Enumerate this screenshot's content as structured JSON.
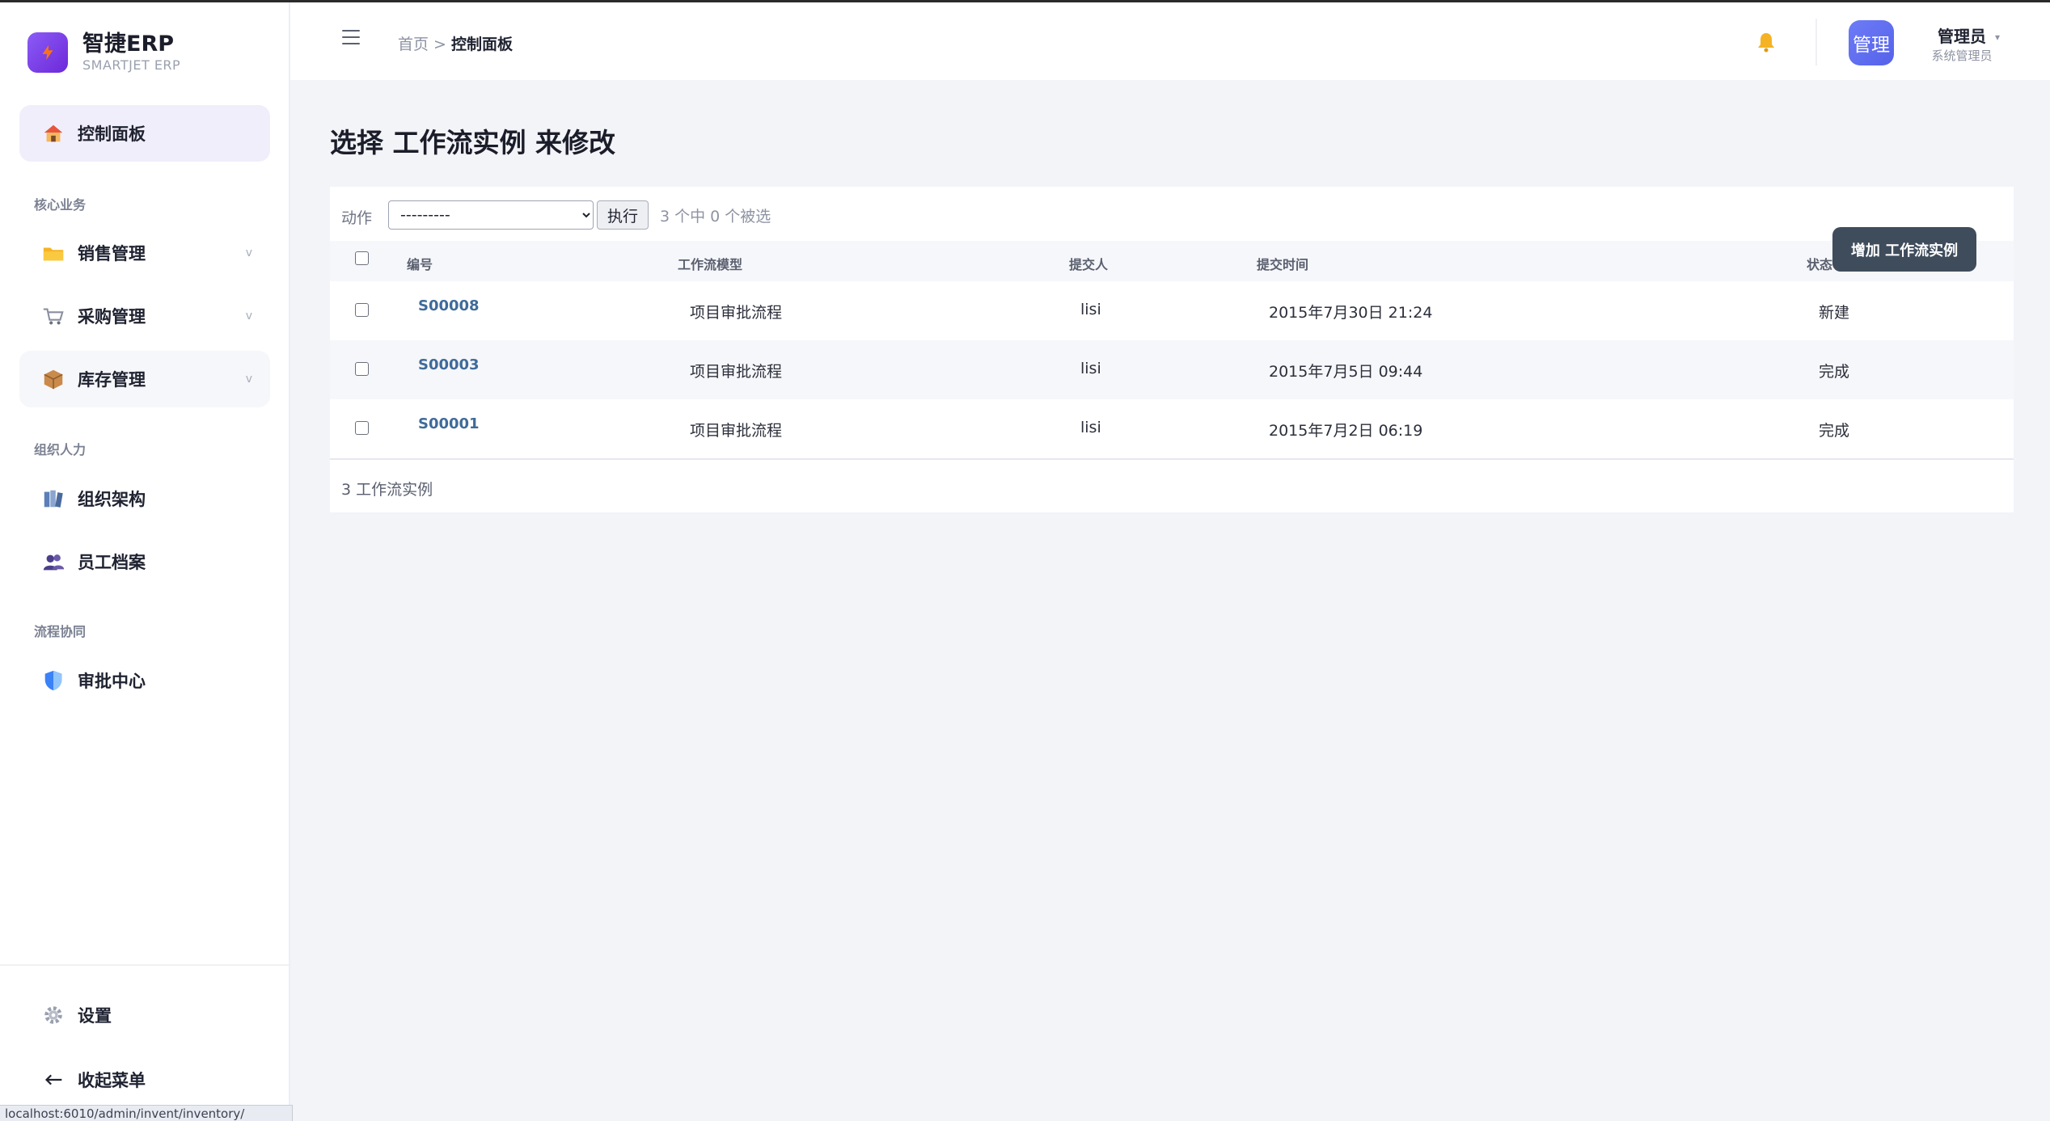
{
  "brand": {
    "name": "智捷ERP",
    "subtitle": "SMARTJET ERP"
  },
  "sidebar": {
    "items": [
      {
        "label": "控制面板",
        "icon": "house-icon"
      },
      {
        "label": "销售管理",
        "icon": "folder-icon"
      },
      {
        "label": "采购管理",
        "icon": "cart-icon"
      },
      {
        "label": "库存管理",
        "icon": "package-icon"
      },
      {
        "label": "组织架构",
        "icon": "books-icon"
      },
      {
        "label": "员工档案",
        "icon": "people-icon"
      },
      {
        "label": "审批中心",
        "icon": "shield-icon"
      }
    ],
    "sections": [
      "核心业务",
      "组织人力",
      "流程协同"
    ],
    "chevron": "v",
    "bottom": {
      "settings_label": "设置",
      "collapse_label": "收起菜单"
    }
  },
  "header": {
    "breadcrumb_home": "首页",
    "breadcrumb_sep": ">",
    "breadcrumb_current": "控制面板",
    "user": {
      "avatar_text": "管理",
      "name": "管理员",
      "role": "系统管理员"
    }
  },
  "page": {
    "title": "选择 工作流实例 来修改",
    "add_button": "增加 工作流实例",
    "action_label": "动作",
    "action_select_value": "---------",
    "action_go": "执行",
    "action_counter": "3 个中 0 个被选",
    "result_count": "3 工作流实例"
  },
  "table": {
    "columns": [
      "编号",
      "工作流模型",
      "提交人",
      "提交时间",
      "状态"
    ],
    "rows": [
      {
        "id": "S00008",
        "model": "项目审批流程",
        "submitter": "lisi",
        "time": "2015年7月30日 21:24",
        "status": "新建"
      },
      {
        "id": "S00003",
        "model": "项目审批流程",
        "submitter": "lisi",
        "time": "2015年7月5日 09:44",
        "status": "完成"
      },
      {
        "id": "S00001",
        "model": "项目审批流程",
        "submitter": "lisi",
        "time": "2015年7月2日 06:19",
        "status": "完成"
      }
    ]
  },
  "status_bar_url": "localhost:6010/admin/invent/inventory/",
  "colors": {
    "accent": "#7c3aed",
    "active_nav_bg": "#f1eefb",
    "link": "#3f6b9a",
    "add_button_bg": "#3f4c5c",
    "avatar_bg": "#5f6ff0"
  }
}
